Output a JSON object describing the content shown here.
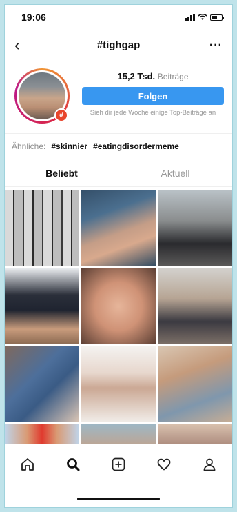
{
  "status_bar": {
    "time": "19:06"
  },
  "nav": {
    "title": "#tighgap",
    "back_glyph": "‹",
    "more_glyph": "···"
  },
  "profile": {
    "post_count": "15,2 Tsd.",
    "post_label": "Beiträge",
    "follow_label": "Folgen",
    "hint": "Sieh dir jede Woche einige Top-Beiträge an",
    "badge_glyph": "#"
  },
  "related": {
    "label": "Ähnliche:",
    "tags": [
      "#skinnier",
      "#eatingdisordermeme"
    ]
  },
  "tabs": [
    {
      "label": "Beliebt",
      "active": true
    },
    {
      "label": "Aktuell",
      "active": false
    }
  ],
  "colors": {
    "follow_button": "#3897f0",
    "badge": "#e8452c"
  },
  "bottom_nav": [
    "home-icon",
    "search-icon",
    "add-post-icon",
    "activity-heart-icon",
    "profile-icon"
  ]
}
